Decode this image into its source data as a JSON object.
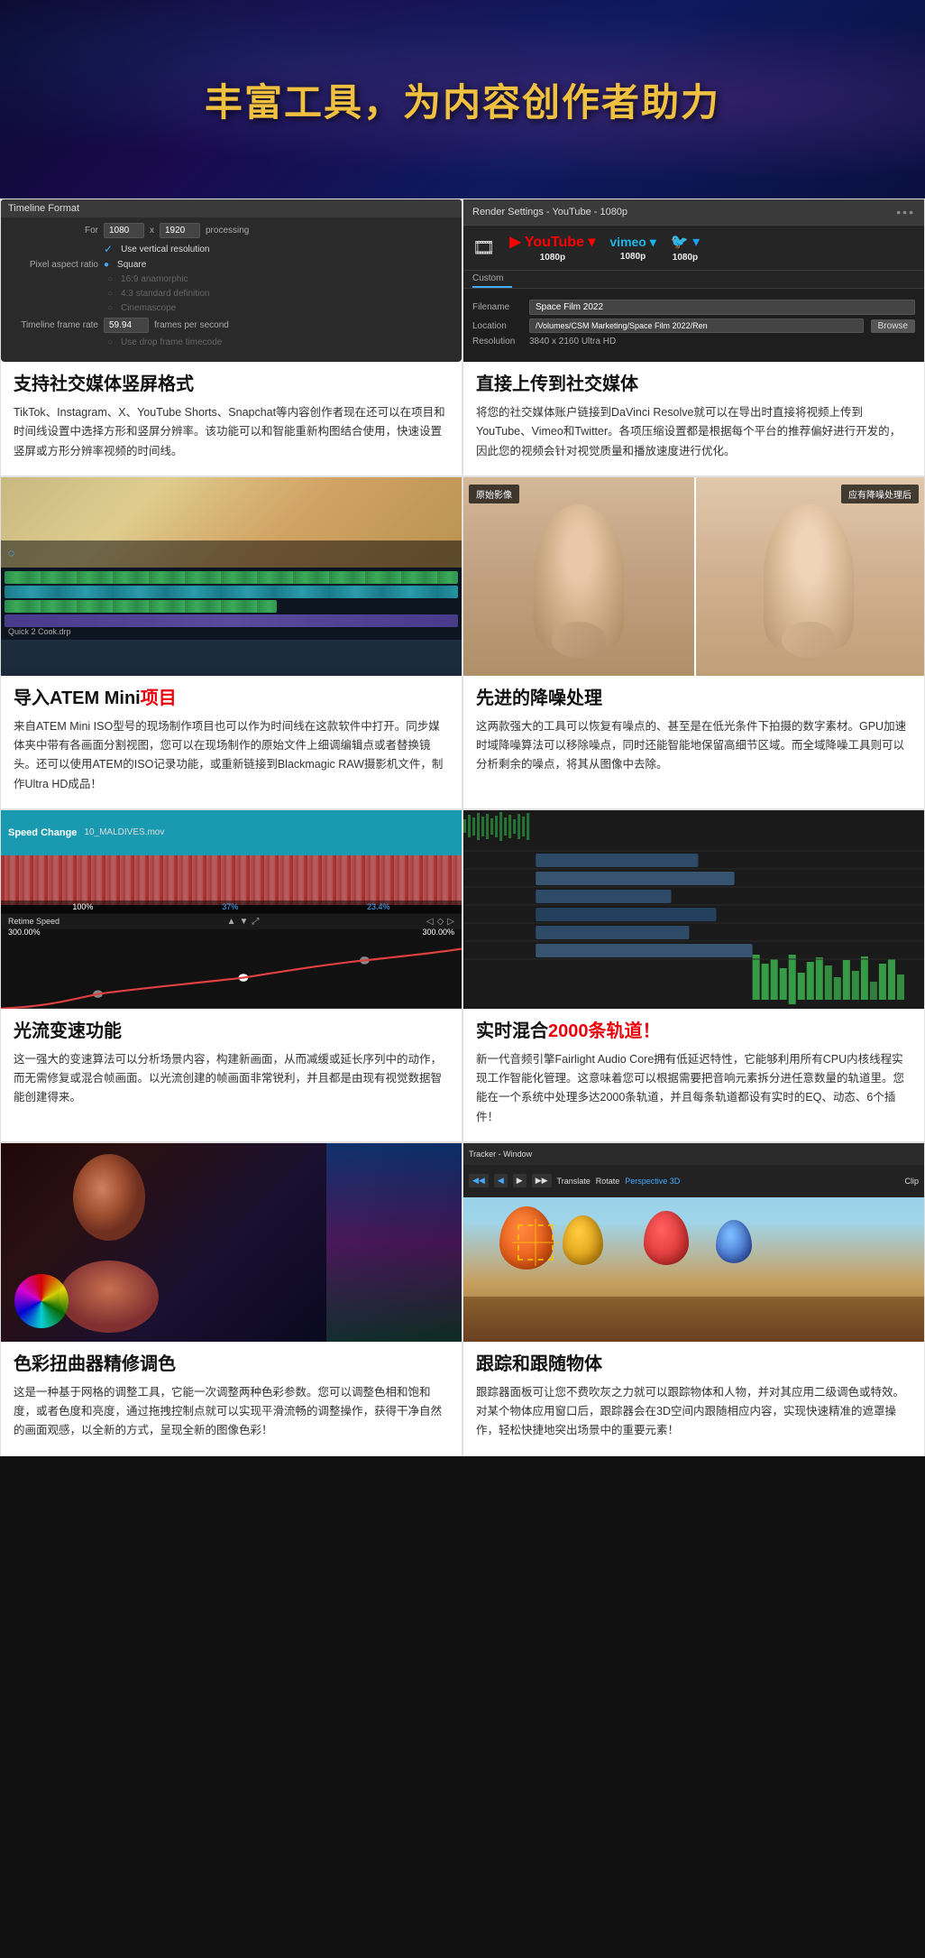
{
  "hero": {
    "title": "丰富工具，为内容创作者助力"
  },
  "features": [
    {
      "id": "social-vertical",
      "title_part1": "支持社交媒体竖屏格式",
      "title_highlight": "",
      "desc": "TikTok、Instagram、X、YouTube Shorts、Snapchat等内容创作者现在还可以在项目和时间线设置中选择方形和竖屏分辨率。该功能可以和智能重新构图结合使用，快速设置竖屏或方形分辨率视频的时间线。",
      "image_type": "timeline-format"
    },
    {
      "id": "social-upload",
      "title_part1": "直接上传到社交媒体",
      "title_highlight": "",
      "desc": "将您的社交媒体账户链接到DaVinci Resolve就可以在导出时直接将视频上传到YouTube、Vimeo和Twitter。各项压缩设置都是根据每个平台的推荐偏好进行开发的，因此您的视频会针对视觉质量和播放速度进行优化。",
      "image_type": "render-settings"
    },
    {
      "id": "atem-mini",
      "title_part1": "导入ATEM Mini",
      "title_highlight": "项目",
      "desc": "来自ATEM Mini ISO型号的现场制作项目也可以作为时间线在这款软件中打开。同步媒体夹中带有各画面分割视图，您可以在现场制作的原始文件上细调编辑点或者替换镜头。还可以使用ATEM的ISO记录功能，或重新链接到Blackmagic RAW摄影机文件，制作Ultra HD成品！",
      "image_type": "atem"
    },
    {
      "id": "noise-reduction",
      "title_part1": "先进的降噪处理",
      "title_highlight": "",
      "desc": "这两款强大的工具可以恢复有噪点的、甚至是在低光条件下拍摄的数字素材。GPU加速时域降噪算法可以移除噪点，同时还能智能地保留高细节区域。而全域降噪工具则可以分析剩余的噪点，将其从图像中去除。",
      "image_type": "noise"
    },
    {
      "id": "optical-flow",
      "title_part1": "光流变速功能",
      "title_highlight": "",
      "desc": "这一强大的变速算法可以分析场景内容，构建新画面，从而减缓或延长序列中的动作，而无需修复或混合帧画面。以光流创建的帧画面非常锐利，并且都是由现有视觉数据智能创建得来。",
      "image_type": "optical"
    },
    {
      "id": "audio-mix",
      "title_part1": "实时混合",
      "title_highlight": "2000条轨道！",
      "desc": "新一代音频引擎Fairlight Audio Core拥有低延迟特性，它能够利用所有CPU内核线程实现工作智能化管理。这意味着您可以根据需要把音响元素拆分进任意数量的轨道里。您能在一个系统中处理多达2000条轨道，并且每条轨道都设有实时的EQ、动态、6个插件！",
      "image_type": "audio"
    },
    {
      "id": "color-grade",
      "title_part1": "色彩扭曲器精修调色",
      "title_highlight": "",
      "desc": "这是一种基于网格的调整工具，它能一次调整两种色彩参数。您可以调整色相和饱和度，或者色度和亮度，通过拖拽控制点就可以实现平滑流畅的调整操作，获得干净自然的画面观感，以全新的方式，呈现全新的图像色彩！",
      "image_type": "color"
    },
    {
      "id": "tracker",
      "title_part1": "跟踪和跟随物体",
      "title_highlight": "",
      "desc": "跟踪器面板可让您不费吹灰之力就可以跟踪物体和人物，并对其应用二级调色或特效。对某个物体应用窗口后，跟踪器会在3D空间内跟随相应内容，实现快速精准的遮罩操作，轻松快捷地突出场景中的重要元素！",
      "image_type": "tracker"
    }
  ],
  "timeline_panel": {
    "title": "Timeline Format",
    "for_label": "For",
    "width": "1080",
    "x_label": "x",
    "height": "1920",
    "processing_label": "processing",
    "use_vertical": "Use vertical resolution",
    "pixel_aspect": "Pixel aspect ratio",
    "square": "Square",
    "anamorphic": "16:9 anamorphic",
    "standard_def": "4:3 standard definition",
    "cinemascope": "Cinemascope",
    "frame_rate": "Timeline frame rate",
    "fps_value": "59.94",
    "fps_label": "frames per second",
    "drop_frame": "Use drop frame timecode"
  },
  "render_panel": {
    "title": "Render Settings - YouTube - 1080p",
    "dots": "•••",
    "platforms": [
      {
        "name": "Custom",
        "quality": ""
      },
      {
        "name": "YouTube",
        "quality": "1080p"
      },
      {
        "name": "Vimeo",
        "quality": "1080p"
      },
      {
        "name": "Twitter",
        "quality": "1080p"
      }
    ],
    "filename_label": "Filename",
    "filename_value": "Space Film 2022",
    "location_label": "Location",
    "location_value": "/Volumes/CSM Marketing/Space Film 2022/Ren",
    "browse_label": "Browse",
    "resolution_label": "Resolution",
    "resolution_value": "3840 x 2160 Ultra HD"
  },
  "noise_labels": {
    "before": "原始影像",
    "after": "应有降噪处理后"
  },
  "speed_change": {
    "title": "Speed Change",
    "file": "10_MALDIVES.mov",
    "pct1": "100%",
    "pct2": "37%",
    "pct3": "23.4%",
    "retime_label": "Retime Speed",
    "speed_value1": "300.00%",
    "speed_value2": "300.00%"
  },
  "cook_label": "Quick 2 Cook.drp"
}
